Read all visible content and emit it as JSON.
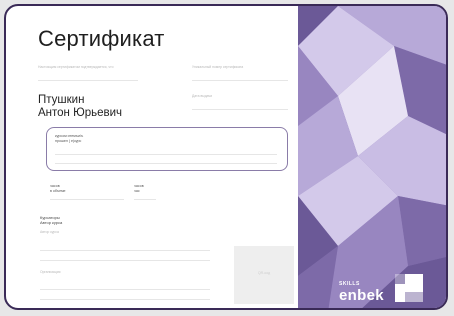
{
  "certificate": {
    "title": "Сертификат",
    "labels": {
      "issued_to": "Настоящим сертификатом подтверждается, что",
      "unique_number": "Уникальный номер сертификата",
      "issue_date": "Дата выдачи",
      "course_intro": "Прошёл(а) обучение по курсу",
      "volume": "Объём обучения",
      "hours": "часов",
      "author": "Автор курса",
      "author_org": "Организация",
      "qr": "QR-код"
    },
    "recipient_name_line1": "Птушкин",
    "recipient_name_line2": "Антон Юрьевич",
    "course_box_line1": "курсом итемъи/ъ",
    "course_box_line2": "прошел ( е)курс",
    "volume_line1": "часов",
    "volume_line2": "в объеме",
    "hours_value": "часов",
    "hours_unit": "час",
    "courseware_line1": "Курсаторы",
    "courseware_line2": "Автор курса"
  },
  "brand": {
    "small": "SKILLS",
    "name": "enbek",
    "panel_colors": [
      "#7d6aa8",
      "#9886c0",
      "#b7a9d8",
      "#d3c9ea",
      "#e8e2f4",
      "#6b5997"
    ]
  }
}
